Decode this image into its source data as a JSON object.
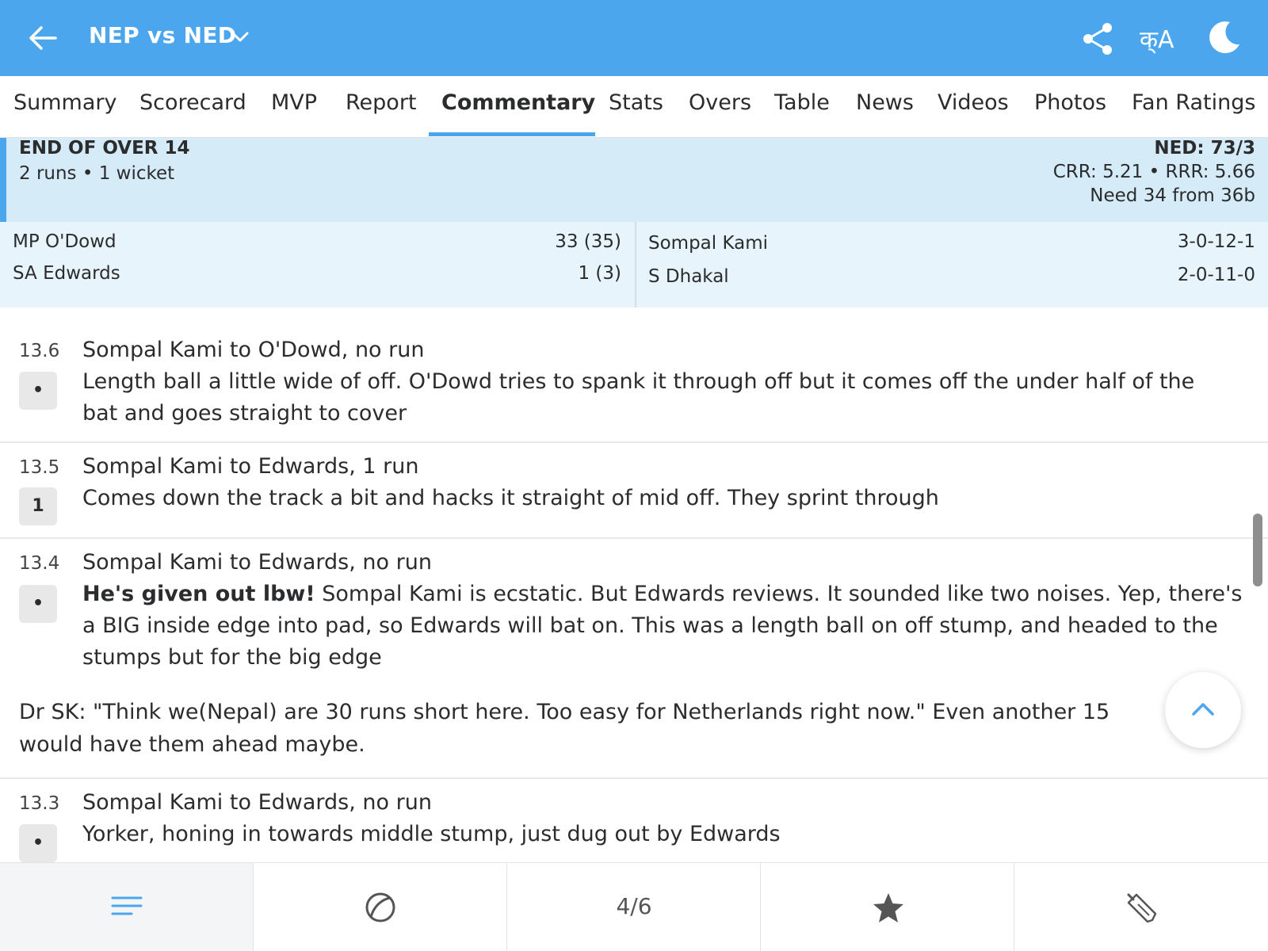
{
  "header": {
    "title": "NEP vs NED",
    "lang_label": "क्A",
    "icons": {
      "back": "back-arrow-icon",
      "chevron": "chevron-down-icon",
      "share": "share-icon",
      "language": "language-icon",
      "theme": "moon-icon"
    }
  },
  "tabs": [
    {
      "label": "Summary"
    },
    {
      "label": "Scorecard"
    },
    {
      "label": "MVP"
    },
    {
      "label": "Report"
    },
    {
      "label": "Commentary"
    },
    {
      "label": "Stats"
    },
    {
      "label": "Overs"
    },
    {
      "label": "Table"
    },
    {
      "label": "News"
    },
    {
      "label": "Videos"
    },
    {
      "label": "Photos"
    },
    {
      "label": "Fan Ratings"
    }
  ],
  "active_tab": "Commentary",
  "over_summary": {
    "title": "END OF OVER 14",
    "runs_wickets": "2 runs • 1 wicket",
    "score": "NED: 73/3",
    "rates": "CRR: 5.21 • RRR: 5.66",
    "need": "Need 34 from 36b"
  },
  "batters": [
    {
      "name": "MP O'Dowd",
      "score": "33 (35)"
    },
    {
      "name": "SA Edwards",
      "score": "1 (3)"
    }
  ],
  "bowlers": [
    {
      "name": "Sompal Kami",
      "figures": "3-0-12-1"
    },
    {
      "name": "S Dhakal",
      "figures": "2-0-11-0"
    }
  ],
  "commentary": [
    {
      "over": "13.6",
      "result": "•",
      "head": "Sompal Kami to O'Dowd, no run",
      "text": "Length ball a little wide of off. O'Dowd tries to spank it through off but it comes off the under half of the bat and goes straight to cover"
    },
    {
      "over": "13.5",
      "result": "1",
      "head": "Sompal Kami to Edwards, 1 run",
      "text": "Comes down the track a bit and hacks it straight of mid off. They sprint through"
    },
    {
      "over": "13.4",
      "result": "•",
      "head": "Sompal Kami to Edwards, no run",
      "text_bold": "He's given out lbw!",
      "text": " Sompal Kami is ecstatic. But Edwards reviews. It sounded like two noises. Yep, there's a BIG inside edge into pad, so Edwards will bat on. This was a length ball on off stump, and headed to the stumps but for the big edge"
    },
    {
      "over": "13.3",
      "result": "•",
      "head": "Sompal Kami to Edwards, no run",
      "text": "Yorker, honing in towards middle stump, just dug out by Edwards"
    }
  ],
  "note": "Dr SK: \"Think we(Nepal) are 30 runs short here. Too easy for Netherlands right now.\" Even another 15 would have them ahead maybe.",
  "bottom_nav": {
    "items": [
      "menu-lines-icon",
      "ball-icon",
      "counter",
      "star-icon",
      "bat-icon"
    ],
    "counter": "4/6",
    "active_index": 0
  },
  "colors": {
    "brand_blue": "#4ba6ee",
    "summary_bg": "#d6ebf8",
    "players_bg": "#e8f4fc"
  }
}
